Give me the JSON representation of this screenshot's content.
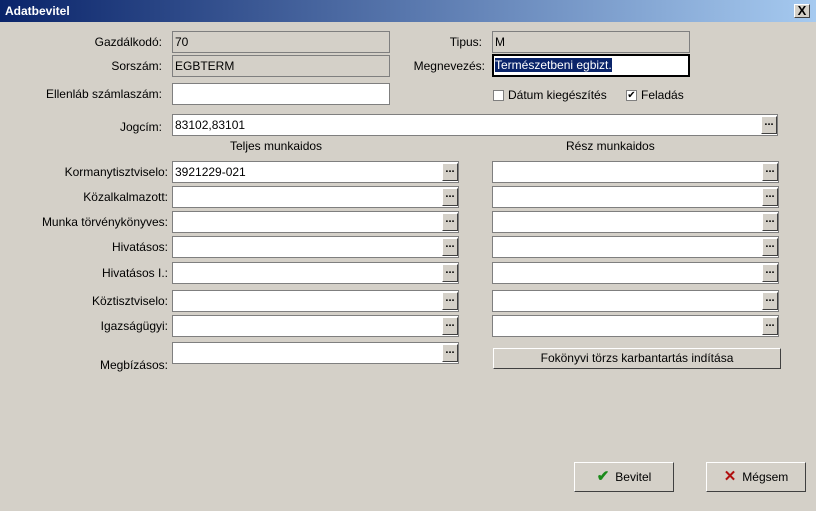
{
  "window": {
    "title": "Adatbevitel",
    "close_glyph": "X"
  },
  "fields": {
    "gazdalkodo": {
      "label": "Gazdálkodó:",
      "value": "70"
    },
    "sorszam": {
      "label": "Sorszám:",
      "value": "EGBTERM"
    },
    "ellenlab": {
      "label": "Ellenláb számlaszám:",
      "value": ""
    },
    "tipus": {
      "label": "Tipus:",
      "value": "M"
    },
    "megnevezes": {
      "label": "Megnevezés:",
      "value": "Természetbeni egbizt."
    },
    "jogcim": {
      "label": "Jogcím:",
      "value": "83102,83101"
    }
  },
  "checkboxes": {
    "datum": {
      "label": "Dátum kiegészítés",
      "checked": false
    },
    "feladas": {
      "label": "Feladás",
      "checked": true
    }
  },
  "columns": {
    "teljes": "Teljes munkaidos",
    "resz": "Rész munkaidos"
  },
  "rows": [
    {
      "label": "Kormanytisztviselo:",
      "teljes": "3921229-021",
      "resz": ""
    },
    {
      "label": "Közalkalmazott:",
      "teljes": "",
      "resz": ""
    },
    {
      "label": "Munka törvénykönyves:",
      "teljes": "",
      "resz": ""
    },
    {
      "label": "Hivatásos:",
      "teljes": "",
      "resz": ""
    },
    {
      "label": "Hivatásos I.:",
      "teljes": "",
      "resz": ""
    },
    {
      "label": "Köztisztviselo:",
      "teljes": "",
      "resz": ""
    },
    {
      "label": "Igazságügyi:",
      "teljes": "",
      "resz": ""
    }
  ],
  "megbizasos": {
    "label": "Megbízásos:",
    "value": ""
  },
  "ellipsis": "...",
  "buttons": {
    "fokonyvi": "Fokönyvi törzs karbantartás indítása",
    "bevitel": "Bevitel",
    "megsem": "Mégsem"
  },
  "icons": {
    "ok": "check-icon",
    "cancel": "x-icon"
  }
}
